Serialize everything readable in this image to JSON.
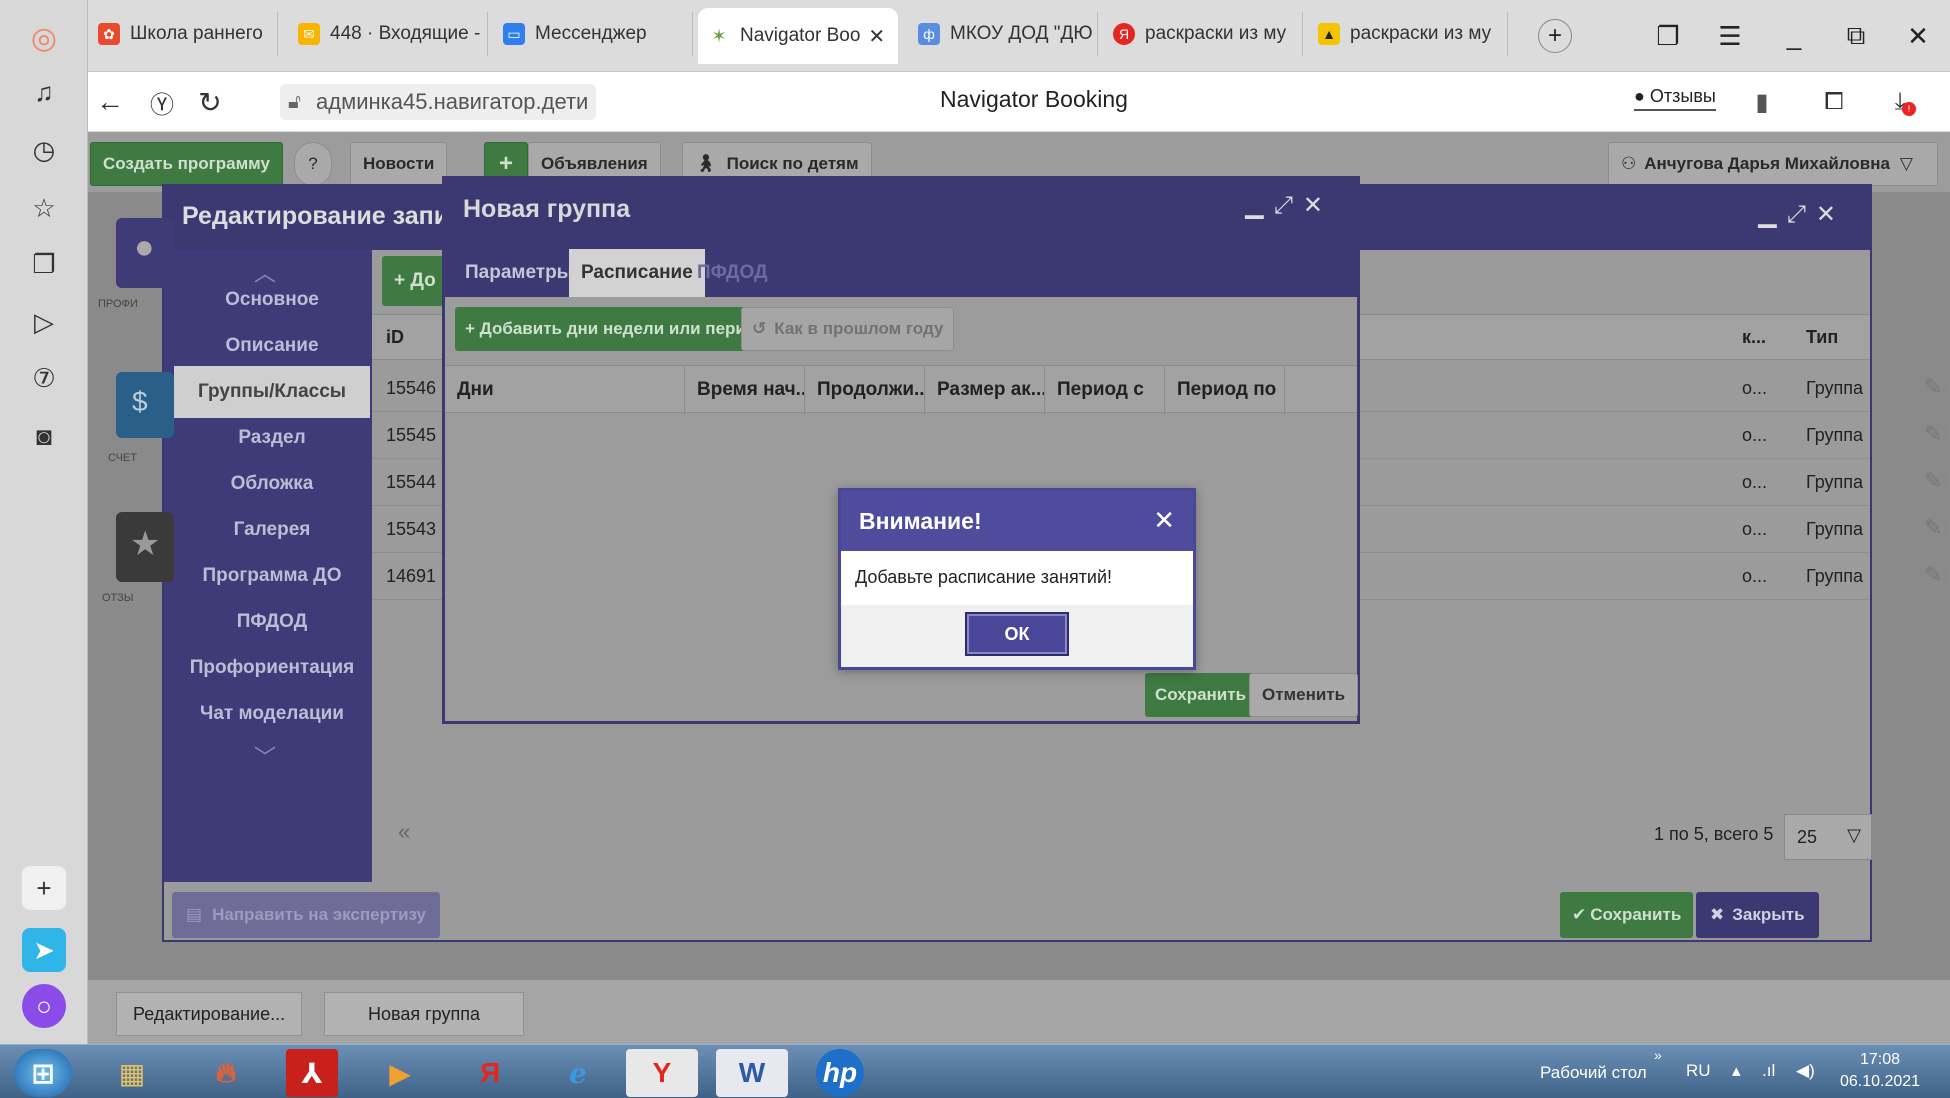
{
  "browser": {
    "tabs": [
      {
        "label": "Школа раннего",
        "icon": "flower-icon",
        "color": "#e84a2e"
      },
      {
        "label": "448 · Входящие -",
        "icon": "mail-icon",
        "color": "#f7b500"
      },
      {
        "label": "Мессенджер",
        "icon": "chat-icon",
        "color": "#2f80ed"
      },
      {
        "label": "Navigator Boo",
        "icon": "navigator-icon",
        "color": "#6a9f3a"
      },
      {
        "label": "МКОУ ДОД \"ДЮ",
        "icon": "globe-icon",
        "color": "#5a8de0"
      },
      {
        "label": "раскраски из му",
        "icon": "yandex-icon",
        "color": "#e52620"
      },
      {
        "label": "раскраски из му",
        "icon": "image-icon",
        "color": "#222"
      }
    ],
    "url": "админка45.навигатор.дети",
    "page_title": "Navigator Booking",
    "feedback_label": "Отзывы",
    "download_badge": "!"
  },
  "topnav": {
    "create_program": "Создать программу",
    "help": "?",
    "news": "Новости",
    "plus": "+",
    "announcements": "Объявления",
    "child_search": "Поиск по детям",
    "user": "Анчугова Дарья Михайловна"
  },
  "outer_modal": {
    "title": "Редактирование запи",
    "menu": [
      "Основное",
      "Описание",
      "Группы/Классы",
      "Раздел",
      "Обложка",
      "Галерея",
      "Программа ДО",
      "ПФДОД",
      "Профориентация",
      "Чат моделации"
    ],
    "side_labels": [
      "ПРОФИ",
      "СЧЕТ",
      "ОТЗЫ"
    ],
    "add_btn": "+ До",
    "columns": {
      "id": "iD",
      "k": "к...",
      "type": "Тип"
    },
    "rows": [
      {
        "id": "15546",
        "k": "о...",
        "type": "Группа"
      },
      {
        "id": "15545",
        "k": "о...",
        "type": "Группа"
      },
      {
        "id": "15544",
        "k": "о...",
        "type": "Группа"
      },
      {
        "id": "15543",
        "k": "о...",
        "type": "Группа"
      },
      {
        "id": "14691",
        "k": "о...",
        "type": "Группа"
      }
    ],
    "pager_prev": "«",
    "pager_info": "1 по 5, всего 5",
    "page_size": "25",
    "send_expertise": "Направить на экспертизу",
    "save": "Сохранить",
    "close": "Закрыть"
  },
  "inner_modal": {
    "title": "Новая группа",
    "tabs": [
      "Параметры",
      "Расписание",
      "ПФДОД"
    ],
    "add_days": "+ Добавить дни недели или период",
    "last_year": "Как в прошлом году",
    "columns": [
      "Дни",
      "Время нач...",
      "Продолжи...",
      "Размер ак....",
      "Период с",
      "Период по"
    ],
    "save": "Сохранить",
    "cancel": "Отменить"
  },
  "dialog": {
    "title": "Внимание!",
    "message": "Добавьте расписание занятий!",
    "ok": "ОК"
  },
  "bottombar": {
    "items": [
      "Редактирование...",
      "Новая группа"
    ]
  },
  "taskbar": {
    "desktop": "Рабочий стол",
    "lang": "RU",
    "time": "17:08",
    "date": "06.10.2021"
  }
}
